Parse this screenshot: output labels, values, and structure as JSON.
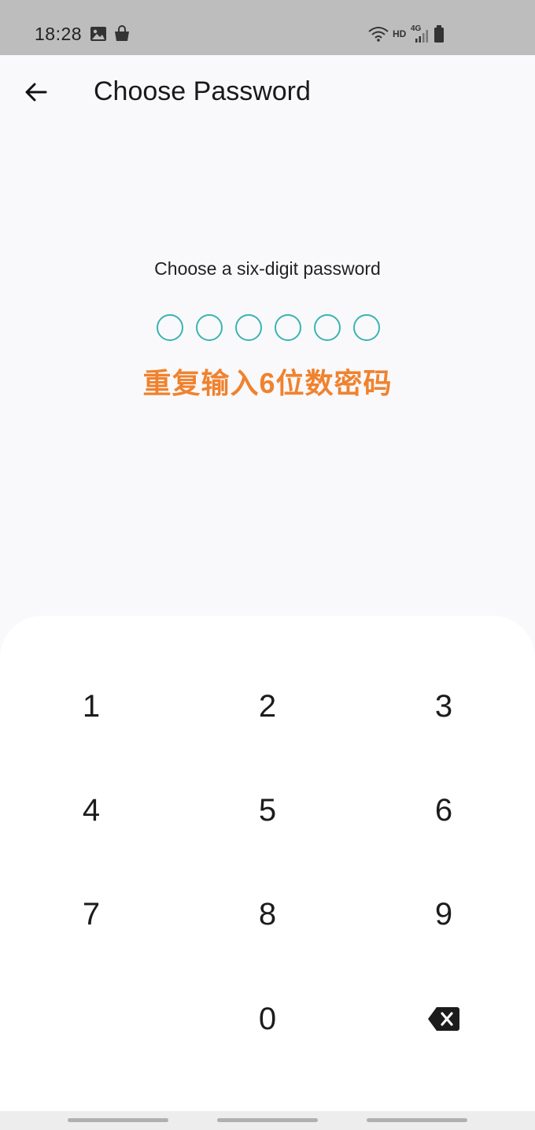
{
  "status_bar": {
    "time": "18:28",
    "hd": "HD",
    "network": "4G",
    "icons": [
      "image-icon",
      "shopping-bag-icon",
      "wifi-icon",
      "signal-icon",
      "battery-icon"
    ]
  },
  "header": {
    "back_icon": "arrow-left-icon",
    "title": "Choose Password"
  },
  "prompt": {
    "text": "Choose a six-digit password",
    "digits_entered": 0,
    "digits_total": 6,
    "dot_color": "#3bb3b3",
    "hint": "重复输入6位数密码",
    "hint_color": "#f0822e"
  },
  "keypad": {
    "keys": [
      "1",
      "2",
      "3",
      "4",
      "5",
      "6",
      "7",
      "8",
      "9",
      "0"
    ],
    "delete_icon": "backspace-icon"
  }
}
